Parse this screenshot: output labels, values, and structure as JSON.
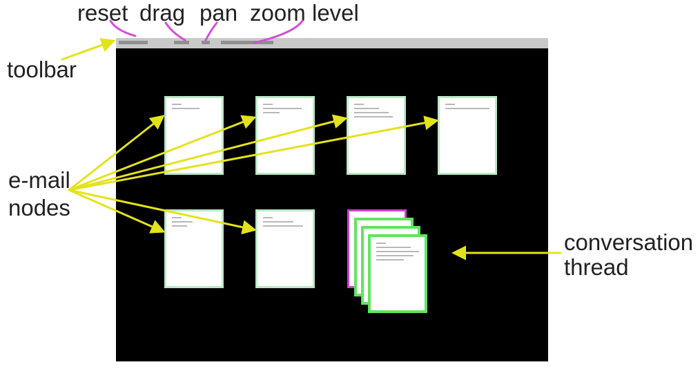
{
  "annotations": {
    "top_labels": [
      "reset",
      "drag",
      "pan",
      "zoom",
      "level"
    ],
    "toolbar": "toolbar",
    "email_nodes": [
      "e-mail",
      "nodes"
    ],
    "thread": [
      "conversation",
      "thread"
    ]
  },
  "colors": {
    "arrow_yellow": "#e3e31c",
    "arrow_magenta": "#d24fd6",
    "thread_green": "#62e35e",
    "thread_magenta": "#d040d0",
    "canvas_bg": "#000000"
  }
}
